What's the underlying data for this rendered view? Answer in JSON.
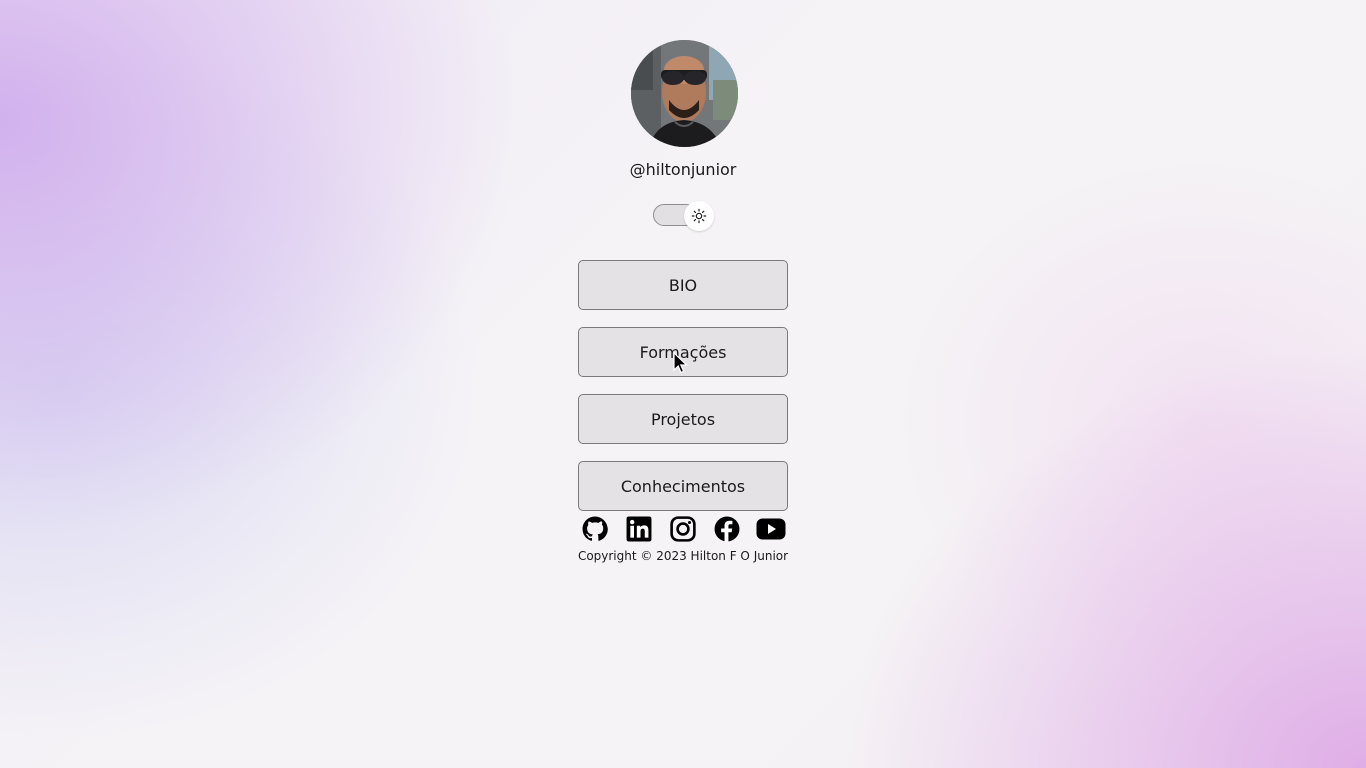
{
  "profile": {
    "username": "@hiltonjunior",
    "avatar_icon": "profile-photo"
  },
  "theme_toggle": {
    "state": "light",
    "icon": "sun-icon"
  },
  "nav": {
    "bio": "BIO",
    "formacoes": "Formações",
    "projetos": "Projetos",
    "conhecimentos": "Conhecimentos"
  },
  "social": [
    {
      "icon": "github-icon"
    },
    {
      "icon": "linkedin-icon"
    },
    {
      "icon": "instagram-icon"
    },
    {
      "icon": "facebook-icon"
    },
    {
      "icon": "youtube-icon"
    }
  ],
  "footer": {
    "copyright": "Copyright © 2023 Hilton F O Junior"
  },
  "colors": {
    "text": "#1a1a1a",
    "button_bg": "#e2dee2",
    "button_border": "#7a7a7a"
  }
}
